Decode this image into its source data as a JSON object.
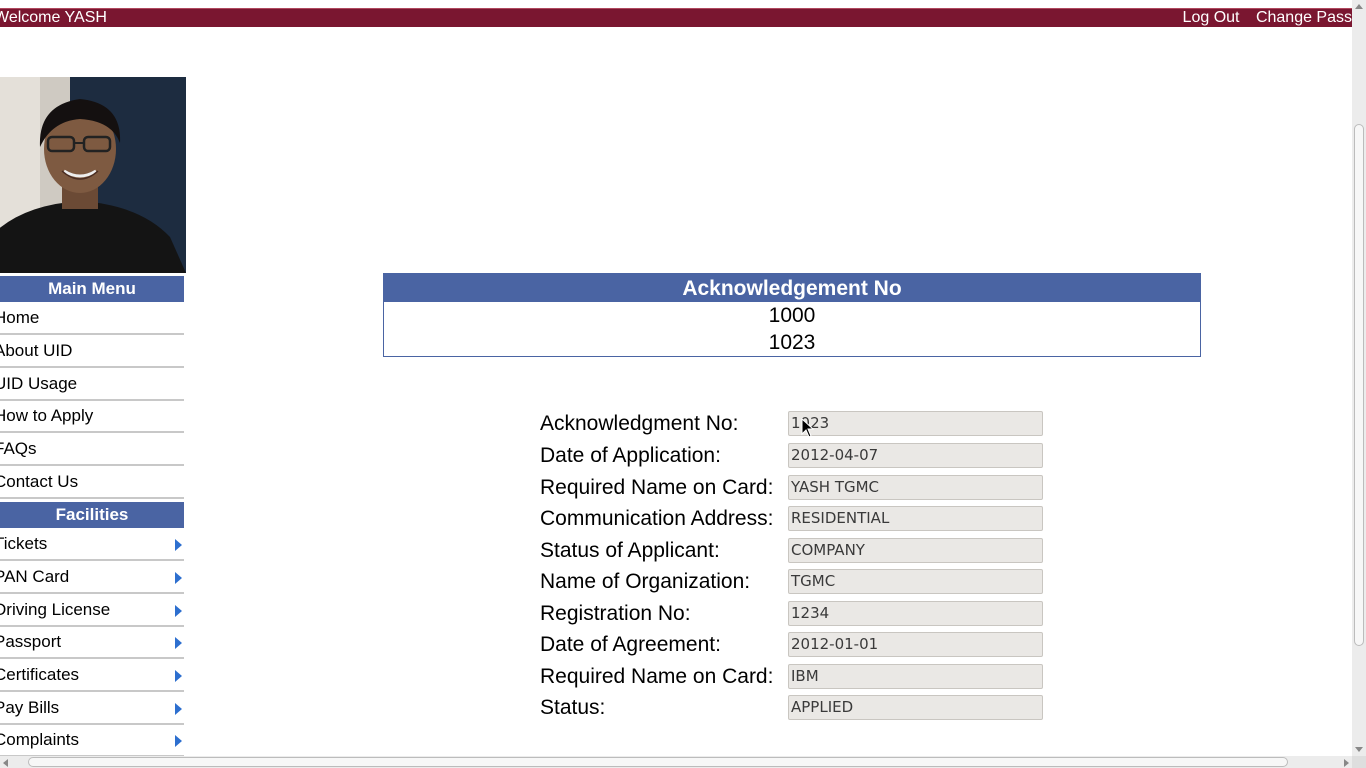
{
  "header": {
    "welcome": "Welcome YASH",
    "logout_label": "Log Out",
    "change_password_label": "Change Pass"
  },
  "sidebar": {
    "main_menu_title": "Main Menu",
    "main_items": [
      "Home",
      "About UID",
      "UID Usage",
      "How to Apply",
      "FAQs",
      "Contact Us"
    ],
    "facilities_title": "Facilities",
    "facility_items": [
      "Tickets",
      "PAN Card",
      "Driving License",
      "Passport",
      "Certificates",
      "Pay Bills",
      "Complaints"
    ]
  },
  "ack_table": {
    "header": "Acknowledgement No",
    "rows": [
      "1000",
      "1023"
    ]
  },
  "form": {
    "fields": [
      {
        "label": "Acknowledgment No:",
        "value": "1023"
      },
      {
        "label": "Date of Application:",
        "value": "2012-04-07"
      },
      {
        "label": "Required Name on Card:",
        "value": "YASH TGMC"
      },
      {
        "label": "Communication Address:",
        "value": "RESIDENTIAL"
      },
      {
        "label": "Status of Applicant:",
        "value": "COMPANY"
      },
      {
        "label": "Name of Organization:",
        "value": "TGMC"
      },
      {
        "label": "Registration No:",
        "value": "1234"
      },
      {
        "label": "Date of Agreement:",
        "value": "2012-01-01"
      },
      {
        "label": "Required Name on Card:",
        "value": "IBM"
      },
      {
        "label": "Status:",
        "value": "APPLIED"
      }
    ]
  },
  "colors": {
    "topbar": "#7a1630",
    "menu_header": "#4a64a3",
    "arrow": "#2d6fcf"
  }
}
